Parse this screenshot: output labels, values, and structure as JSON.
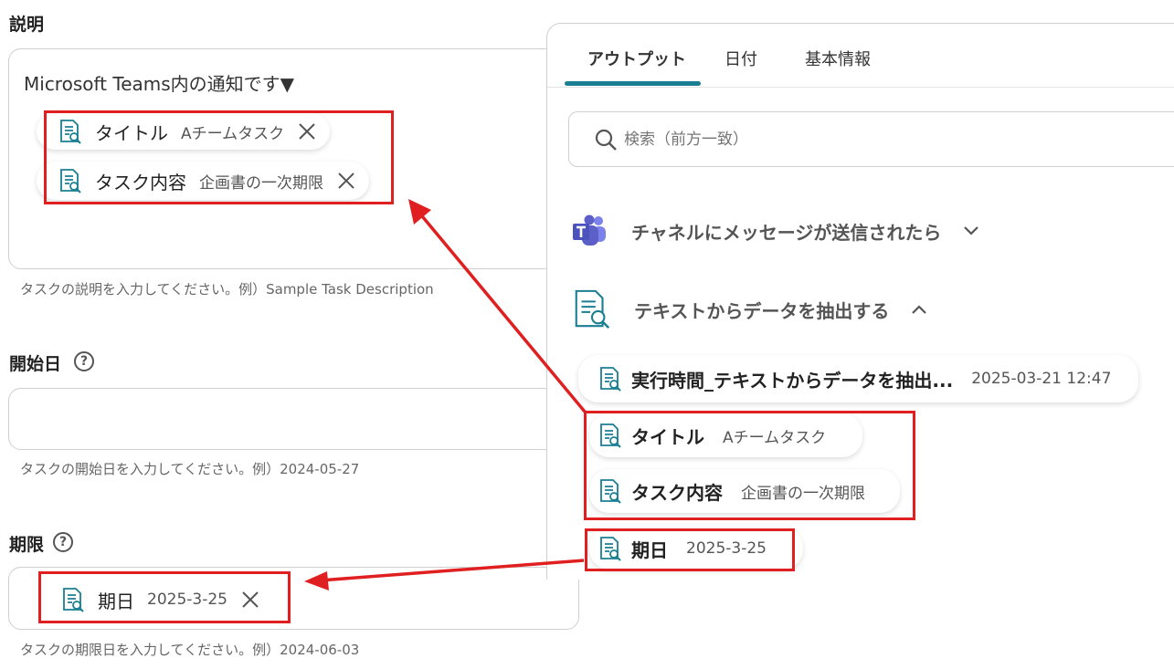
{
  "form": {
    "description": {
      "label": "説明",
      "text": "Microsoft Teams内の通知です▼",
      "hint": "タスクの説明を入力してください。例）Sample Task Description",
      "chips": [
        {
          "key": "タイトル",
          "value": "Aチームタスク"
        },
        {
          "key": "タスク内容",
          "value": "企画書の一次期限"
        }
      ]
    },
    "start_date": {
      "label": "開始日",
      "help": "?",
      "hint": "タスクの開始日を入力してください。例）2024-05-27"
    },
    "deadline": {
      "label": "期限",
      "help": "?",
      "hint": "タスクの期限日を入力してください。例）2024-06-03",
      "chip": {
        "key": "期日",
        "value": "2025-3-25"
      }
    }
  },
  "panel": {
    "tabs": [
      "アウトプット",
      "日付",
      "基本情報"
    ],
    "active_tab": "アウトプット",
    "search": {
      "placeholder": "検索（前方一致）"
    },
    "sections": [
      {
        "label": "チャネルにメッセージが送信されたら",
        "icon": "teams-icon",
        "state": "collapsed"
      },
      {
        "label": "テキストからデータを抽出する",
        "icon": "document-search-icon",
        "state": "expanded"
      }
    ],
    "items": [
      {
        "key": "実行時間_テキストからデータを抽出...",
        "value": "2025-03-21 12:47"
      },
      {
        "key": "タイトル",
        "value": "Aチームタスク"
      },
      {
        "key": "タスク内容",
        "value": "企画書の一次期限"
      },
      {
        "key": "期日",
        "value": "2025-3-25"
      }
    ]
  },
  "colors": {
    "highlight": "#e02020",
    "accent": "#1a7f92",
    "teams": "#5b5fc7"
  }
}
